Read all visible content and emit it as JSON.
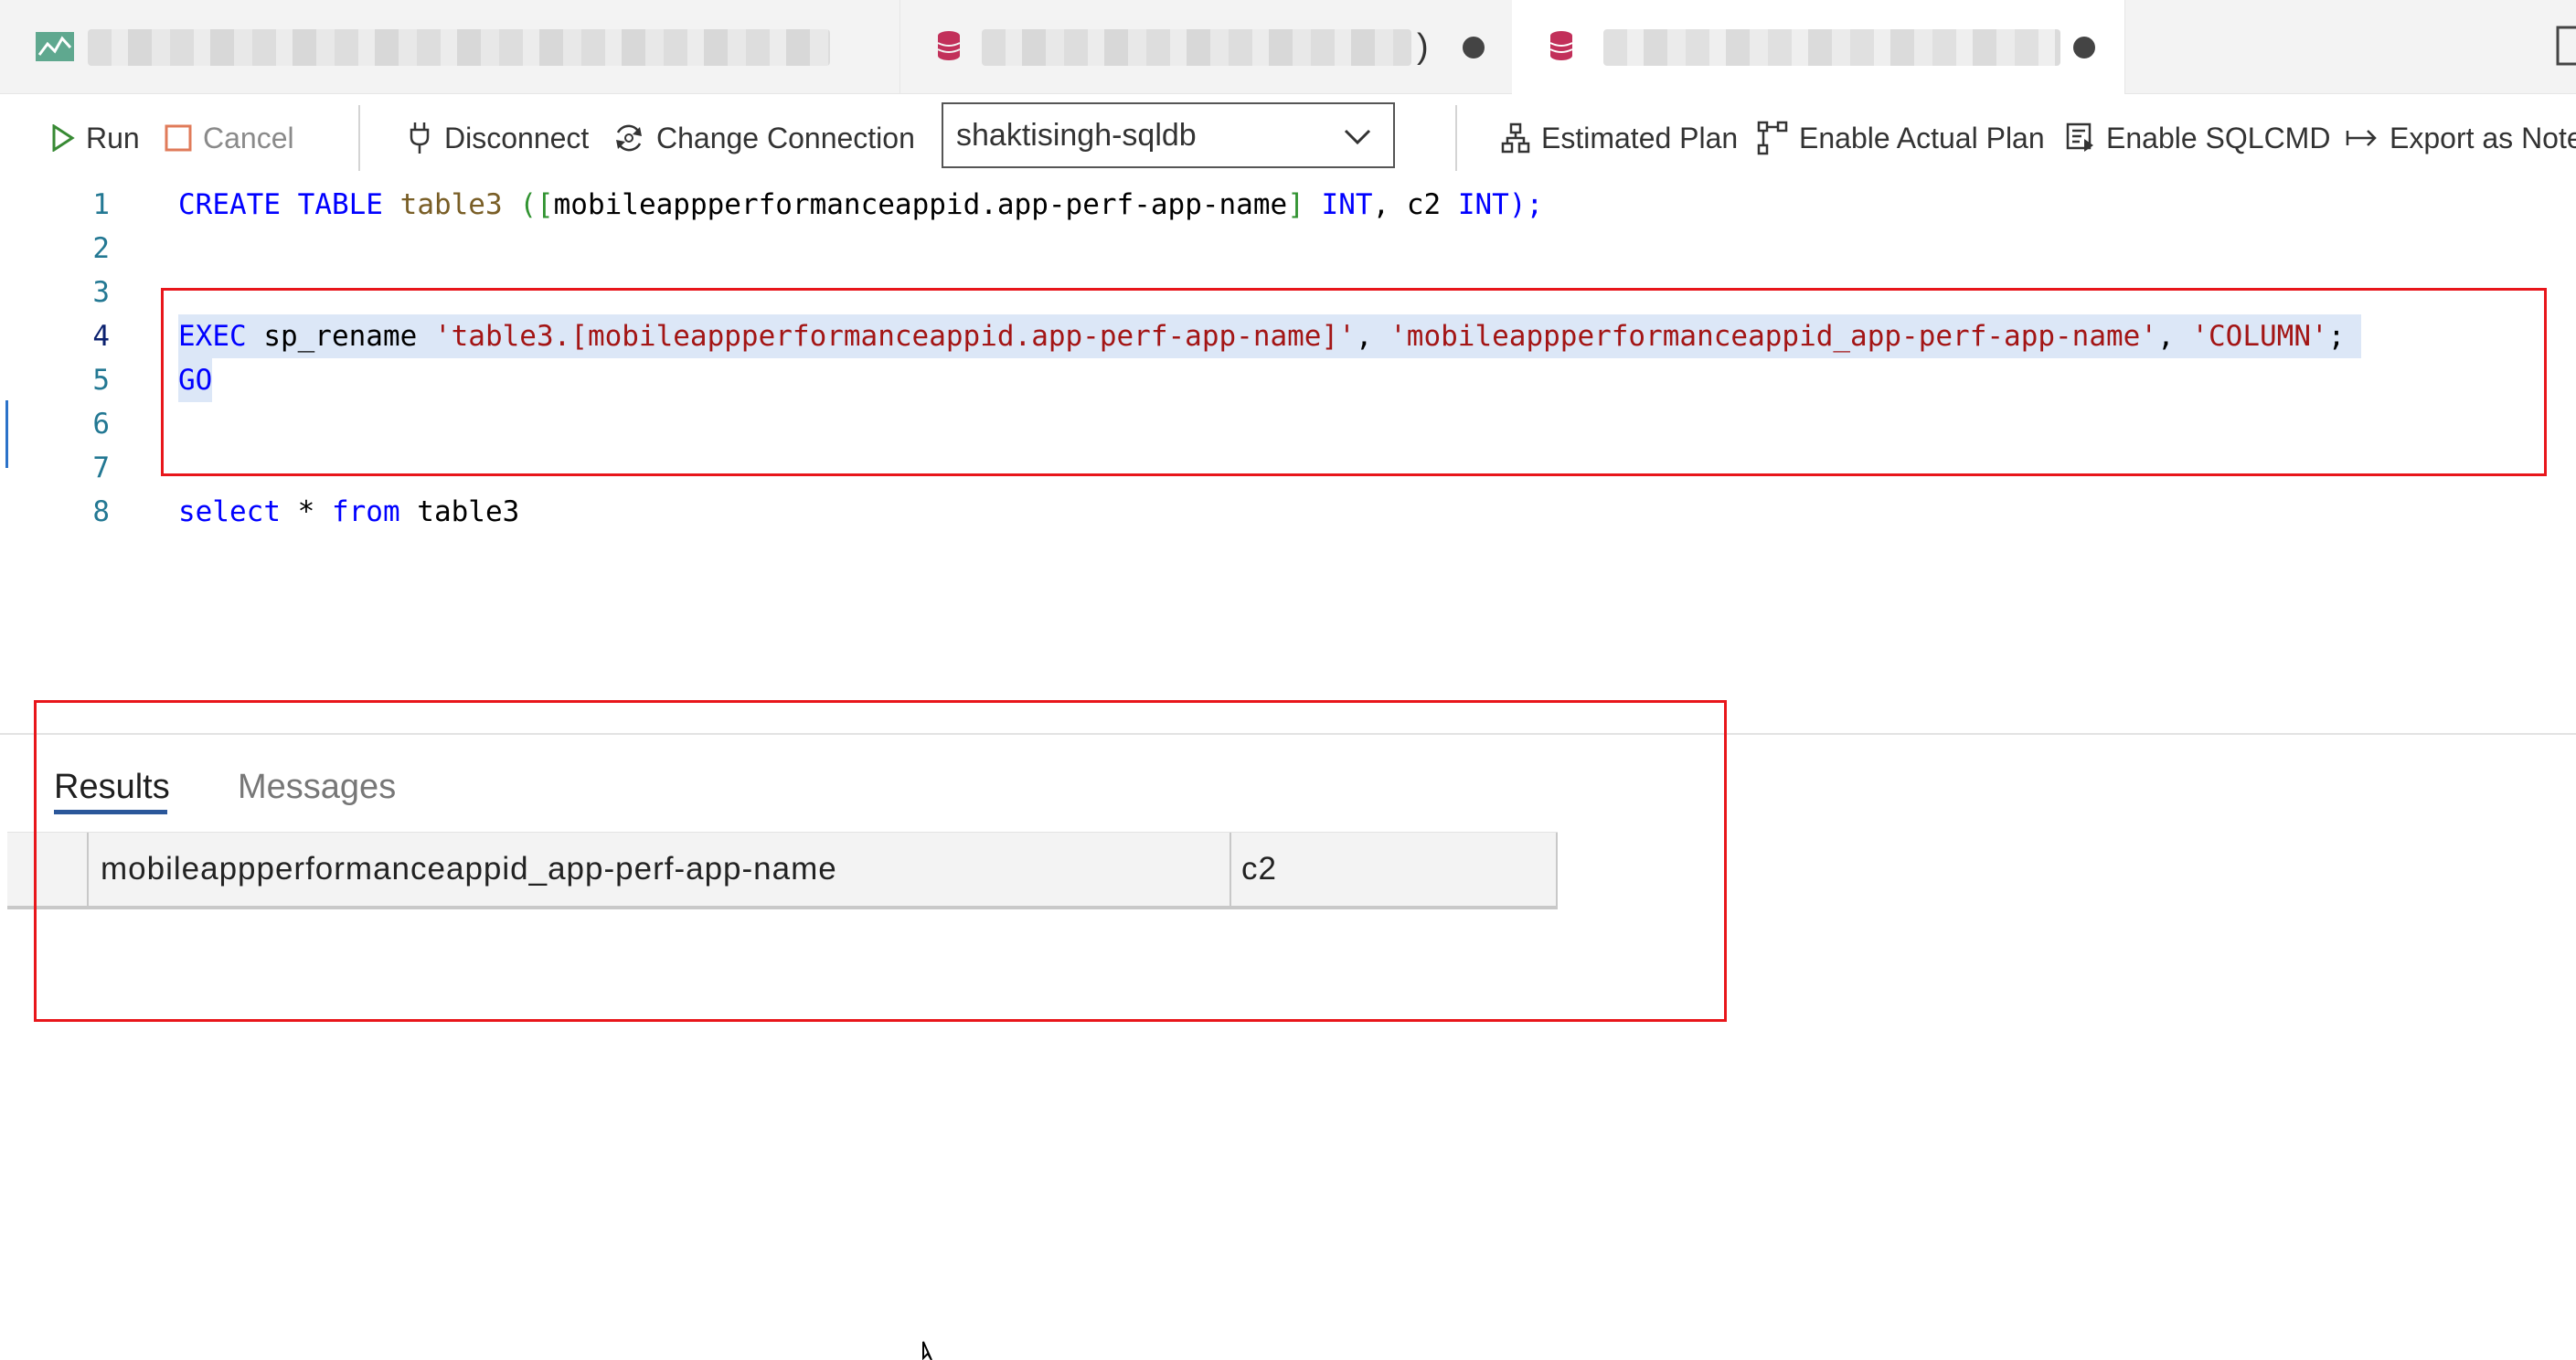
{
  "window": {
    "tabs": [
      {
        "icon": "activity-chart-icon",
        "title": "",
        "active": false
      },
      {
        "icon": "database-icon",
        "title": ")",
        "active": false,
        "dirty": true
      },
      {
        "icon": "database-icon",
        "title": "",
        "active": true,
        "dirty": true
      }
    ]
  },
  "toolbar": {
    "run_label": "Run",
    "cancel_label": "Cancel",
    "disconnect_label": "Disconnect",
    "change_connection_label": "Change Connection",
    "connection_selected": "shaktisingh-sqldb",
    "estimated_plan_label": "Estimated Plan",
    "actual_plan_label": "Enable Actual Plan",
    "sqlcmd_label": "Enable SQLCMD",
    "export_label": "Export as Note"
  },
  "editor": {
    "line_numbers": [
      "1",
      "2",
      "3",
      "4",
      "5",
      "6",
      "7",
      "8"
    ],
    "current_line": "4",
    "lines": {
      "l1_create": "CREATE",
      "l1_table": "TABLE",
      "l1_name": "table3",
      "l1_open": "([",
      "l1_col": "mobileappperformanceappid.app-perf-app-name",
      "l1_close_br": "]",
      "l1_int1": "INT",
      "l1_comma": ", c2 ",
      "l1_int2": "INT",
      "l1_end": ");",
      "l4_exec": "EXEC",
      "l4_proc": " sp_rename ",
      "l4_arg1": "'table3.[mobileappperformanceappid.app-perf-app-name]'",
      "l4_sep1": ", ",
      "l4_arg2": "'mobileappperformanceappid_app-perf-app-name'",
      "l4_sep2": ", ",
      "l4_arg3": "'COLUMN'",
      "l4_end": ";",
      "l5_go": "GO",
      "l8_select": "select",
      "l8_star": " * ",
      "l8_from": "from",
      "l8_table": " table3"
    }
  },
  "results": {
    "tab_results": "Results",
    "tab_messages": "Messages",
    "columns": [
      "mobileappperformanceappid_app-perf-app-name",
      "c2"
    ]
  },
  "colors": {
    "highlight_box": "#e8161b",
    "selection": "#dce7f7",
    "keyword": "#0000ff",
    "string": "#a31515",
    "active_tab_underline": "#2b579a"
  }
}
